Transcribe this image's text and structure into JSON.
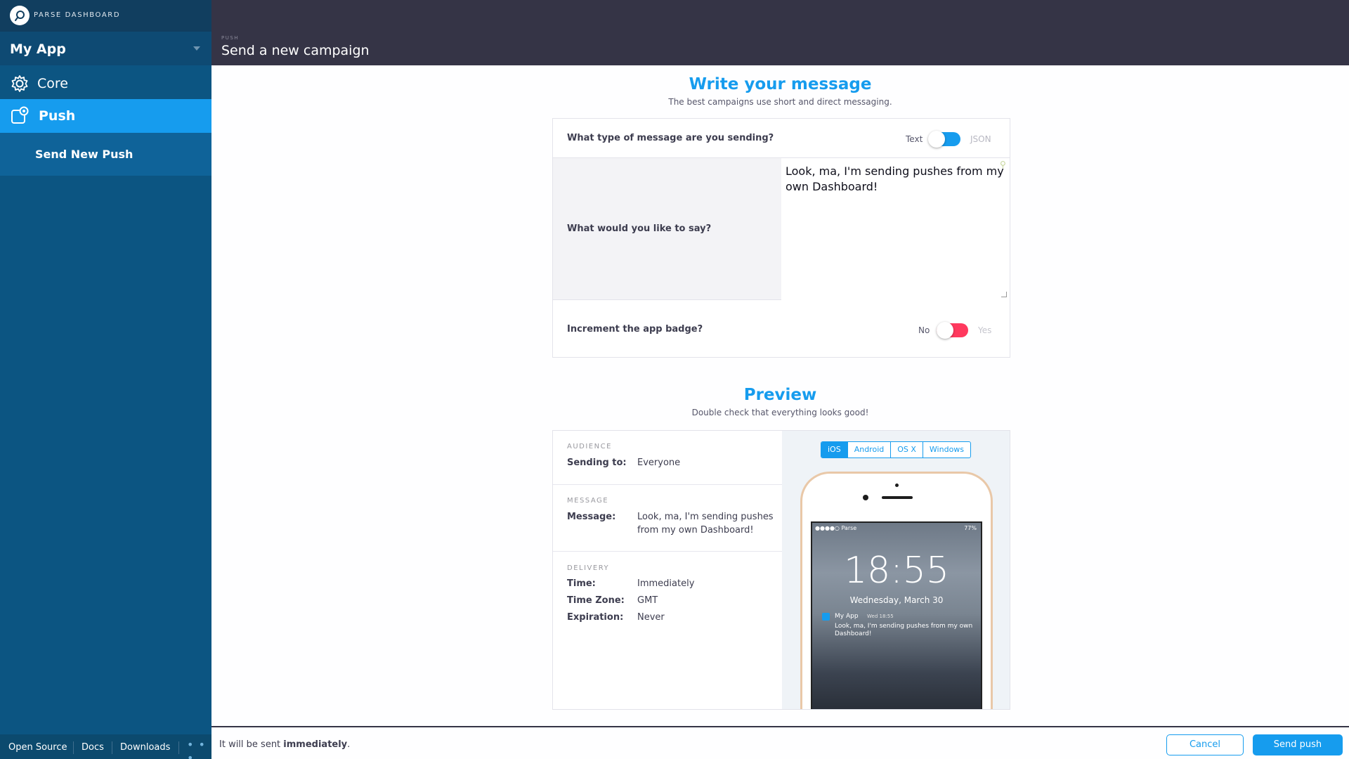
{
  "sidebar": {
    "brand": "PARSE DASHBOARD",
    "app_name": "My App",
    "items": [
      {
        "label": "Core",
        "icon": "gear-icon"
      },
      {
        "label": "Push",
        "icon": "push-icon",
        "active": true
      }
    ],
    "subitems": [
      {
        "label": "Send New Push"
      }
    ],
    "footer": {
      "links": [
        "Open Source",
        "Docs",
        "Downloads"
      ],
      "more": "• • •"
    }
  },
  "header": {
    "breadcrumb": "PUSH",
    "title": "Send a new campaign"
  },
  "message_section": {
    "title": "Write your message",
    "subtitle": "The best campaigns use short and direct messaging.",
    "type_question": "What type of message are you sending?",
    "type_off_label": "Text",
    "type_on_label": "JSON",
    "type_toggle_state": "on",
    "say_question": "What would you like to say?",
    "message_value": "Look, ma, I'm sending pushes from my own Dashboard!",
    "badge_question": "Increment the app badge?",
    "badge_off_label": "No",
    "badge_on_label": "Yes",
    "badge_toggle_state": "off"
  },
  "preview_section": {
    "title": "Preview",
    "subtitle": "Double check that everything looks good!",
    "audience_head": "AUDIENCE",
    "sending_to_key": "Sending to:",
    "sending_to_val": "Everyone",
    "message_head": "MESSAGE",
    "message_key": "Message:",
    "message_val": "Look, ma, I'm sending pushes from my own Dashboard!",
    "delivery_head": "DELIVERY",
    "time_key": "Time:",
    "time_val": "Immediately",
    "tz_key": "Time Zone:",
    "tz_val": "GMT",
    "exp_key": "Expiration:",
    "exp_val": "Never",
    "platforms": [
      "iOS",
      "Android",
      "OS X",
      "Windows"
    ],
    "selected_platform": "iOS",
    "phone": {
      "carrier": "●●●●○ Parse",
      "battery": "77%",
      "time": "18:55",
      "date": "Wednesday, March 30",
      "notif_app": "My App",
      "notif_time": "Wed 18:55",
      "notif_body": "Look, ma, I'm sending pushes from my own Dashboard!"
    }
  },
  "bottom": {
    "note_prefix": "It will be sent ",
    "note_emph": "immediately",
    "note_suffix": ".",
    "cancel_label": "Cancel",
    "send_label": "Send push"
  },
  "colors": {
    "accent": "#169cee",
    "sidebar": "#0c5582",
    "header": "#353446",
    "toggle_on": "#169cee",
    "toggle_off": "#ff395e"
  }
}
